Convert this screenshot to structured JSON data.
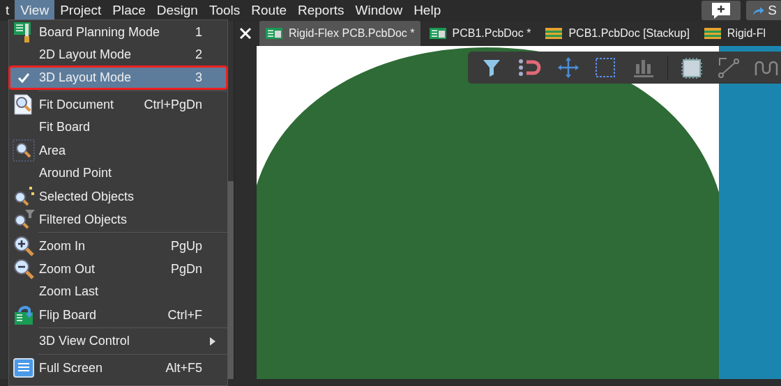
{
  "menubar": {
    "items": [
      {
        "label": "t",
        "selected": false
      },
      {
        "label": "View",
        "selected": true
      },
      {
        "label": "Project",
        "selected": false
      },
      {
        "label": "Place",
        "selected": false
      },
      {
        "label": "Design",
        "selected": false
      },
      {
        "label": "Tools",
        "selected": false
      },
      {
        "label": "Route",
        "selected": false
      },
      {
        "label": "Reports",
        "selected": false
      },
      {
        "label": "Window",
        "selected": false
      },
      {
        "label": "Help",
        "selected": false
      }
    ],
    "share_button": {
      "label": "S"
    }
  },
  "tabs": [
    {
      "label": "Rigid-Flex PCB.PcbDoc *",
      "selected": true,
      "kind": "pcb"
    },
    {
      "label": "PCB1.PcbDoc *",
      "selected": false,
      "kind": "pcb"
    },
    {
      "label": "PCB1.PcbDoc [Stackup]",
      "selected": false,
      "kind": "stackup"
    },
    {
      "label": "Rigid-Fl",
      "selected": false,
      "kind": "stackup"
    }
  ],
  "view_menu": {
    "items": [
      {
        "label": "Board Planning Mode",
        "shortcut": "1",
        "kind": "board",
        "checked": false,
        "selected": false,
        "divider": false
      },
      {
        "label": "2D Layout Mode",
        "shortcut": "2",
        "kind": "plain",
        "checked": false,
        "selected": false,
        "divider": false
      },
      {
        "label": "3D Layout Mode",
        "shortcut": "3",
        "kind": "plain",
        "checked": true,
        "selected": true,
        "divider": false
      },
      {
        "label": "Fit Document",
        "shortcut": "Ctrl+PgDn",
        "kind": "doc-zoom",
        "checked": false,
        "selected": false,
        "divider": true
      },
      {
        "label": "Fit Board",
        "kind": "plain",
        "checked": false,
        "selected": false,
        "divider": false
      },
      {
        "label": "Area",
        "kind": "area-zoom",
        "checked": false,
        "selected": false,
        "divider": false
      },
      {
        "label": "Around Point",
        "kind": "plain",
        "checked": false,
        "selected": false,
        "divider": false
      },
      {
        "label": "Selected Objects",
        "kind": "selected-zoom",
        "checked": false,
        "selected": false,
        "divider": false
      },
      {
        "label": "Filtered Objects",
        "kind": "filter-zoom",
        "checked": false,
        "selected": false,
        "divider": false
      },
      {
        "label": "Zoom In",
        "shortcut": "PgUp",
        "kind": "zoom-in",
        "checked": false,
        "selected": false,
        "divider": true
      },
      {
        "label": "Zoom Out",
        "shortcut": "PgDn",
        "kind": "zoom-out",
        "checked": false,
        "selected": false,
        "divider": false
      },
      {
        "label": "Zoom Last",
        "kind": "plain",
        "checked": false,
        "selected": false,
        "divider": false
      },
      {
        "label": "Flip Board",
        "shortcut": "Ctrl+F",
        "kind": "flip",
        "checked": false,
        "selected": false,
        "divider": false
      },
      {
        "label": "3D View Control",
        "kind": "plain",
        "checked": false,
        "selected": false,
        "divider": true,
        "submenu": true
      },
      {
        "label": "Full Screen",
        "shortcut": "Alt+F5",
        "kind": "screen",
        "checked": false,
        "selected": false,
        "divider": true
      }
    ]
  }
}
